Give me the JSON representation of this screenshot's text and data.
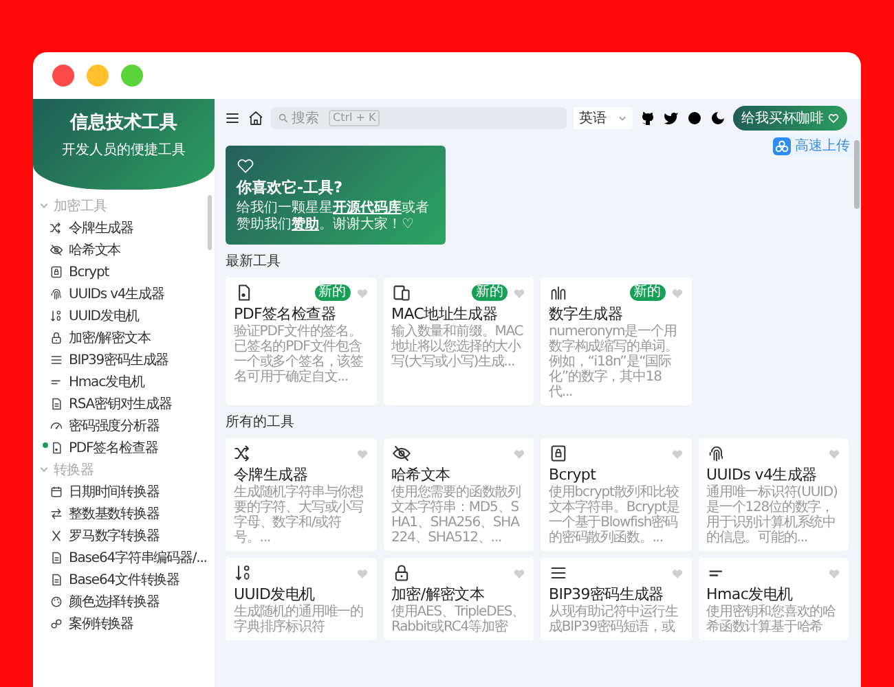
{
  "sidebar": {
    "title": "信息技术工具",
    "subtitle": "开发人员的便捷工具",
    "sections": [
      {
        "label": "加密工具",
        "expanded": true,
        "items": [
          {
            "label": "令牌生成器",
            "is_new": false
          },
          {
            "label": "哈希文本",
            "is_new": false
          },
          {
            "label": "Bcrypt",
            "is_new": false
          },
          {
            "label": "UUIDs v4生成器",
            "is_new": false
          },
          {
            "label": "UUID发电机",
            "is_new": false
          },
          {
            "label": "加密/解密文本",
            "is_new": false
          },
          {
            "label": "BIP39密码生成器",
            "is_new": false
          },
          {
            "label": "Hmac发电机",
            "is_new": false
          },
          {
            "label": "RSA密钥对生成器",
            "is_new": false
          },
          {
            "label": "密码强度分析器",
            "is_new": false
          },
          {
            "label": "PDF签名检查器",
            "is_new": true
          }
        ]
      },
      {
        "label": "转换器",
        "expanded": true,
        "items": [
          {
            "label": "日期时间转换器",
            "is_new": false
          },
          {
            "label": "整数基数转换器",
            "is_new": false
          },
          {
            "label": "罗马数字转换器",
            "is_new": false
          },
          {
            "label": "Base64字符串编码器/...",
            "is_new": false
          },
          {
            "label": "Base64文件转换器",
            "is_new": false
          },
          {
            "label": "颜色选择转换器",
            "is_new": false
          },
          {
            "label": "案例转换器",
            "is_new": false
          }
        ]
      }
    ]
  },
  "header": {
    "search": {
      "placeholder": "搜索",
      "shortcut": "Ctrl + K"
    },
    "language": {
      "value": "英语"
    },
    "donate_button": "给我买杯咖啡"
  },
  "floating_badge": {
    "label": "高速上传"
  },
  "hero": {
    "title": "你喜欢它-工具?",
    "segments": [
      {
        "kind": "text",
        "text": "给我们一颗星星"
      },
      {
        "kind": "link",
        "text": "开源代码库"
      },
      {
        "kind": "text",
        "text": "或者赞助我们"
      },
      {
        "kind": "link",
        "text": "赞助"
      },
      {
        "kind": "text",
        "text": "。谢谢大家！♡"
      }
    ]
  },
  "latest_tools": {
    "heading": "最新工具",
    "cards": [
      {
        "title": "PDF签名检查器",
        "description": "验证PDF文件的签名。已签名的PDF文件包含一个或多个签名，该签名可用于确定自文...",
        "badge": "新的",
        "favorite": false
      },
      {
        "title": "MAC地址生成器",
        "description": "输入数量和前缀。MAC地址将以您选择的大小写(大写或小写)生成...",
        "badge": "新的",
        "favorite": false
      },
      {
        "title": "数字生成器",
        "description": "numeronym是一个用数字构成缩写的单词。例如，“i18n”是“国际化”的数字，其中18代...",
        "badge": "新的",
        "favorite": false
      }
    ]
  },
  "all_tools": {
    "heading": "所有的工具",
    "cards": [
      {
        "title": "令牌生成器",
        "description": "生成随机字符串与你想要的字符、大写或小写字母、数字和/或符号。...",
        "favorite": false
      },
      {
        "title": "哈希文本",
        "description": "使用您需要的函数散列文本字符串：MD5、SHA1、SHA256、SHA224、SHA512、...",
        "favorite": false
      },
      {
        "title": "Bcrypt",
        "description": "使用bcrypt散列和比较文本字符串。Bcrypt是一个基于Blowfish密码的密码散列函数。...",
        "favorite": false
      },
      {
        "title": "UUIDs v4生成器",
        "description": "通用唯一标识符(UUID)是一个128位的数字，用于识别计算机系统中的信息。可能的...",
        "favorite": false
      },
      {
        "title": "UUID发电机",
        "description": "生成随机的通用唯一的字典排序标识符",
        "favorite": false
      },
      {
        "title": "加密/解密文本",
        "description": "使用AES、TripleDES、Rabbit或RC4等加密",
        "favorite": false
      },
      {
        "title": "BIP39密码生成器",
        "description": "从现有助记符中运行生成BIP39密码短语，或",
        "favorite": false
      },
      {
        "title": "Hmac发电机",
        "description": "使用密钥和您喜欢的哈希函数计算基于哈希",
        "favorite": false
      }
    ]
  }
}
